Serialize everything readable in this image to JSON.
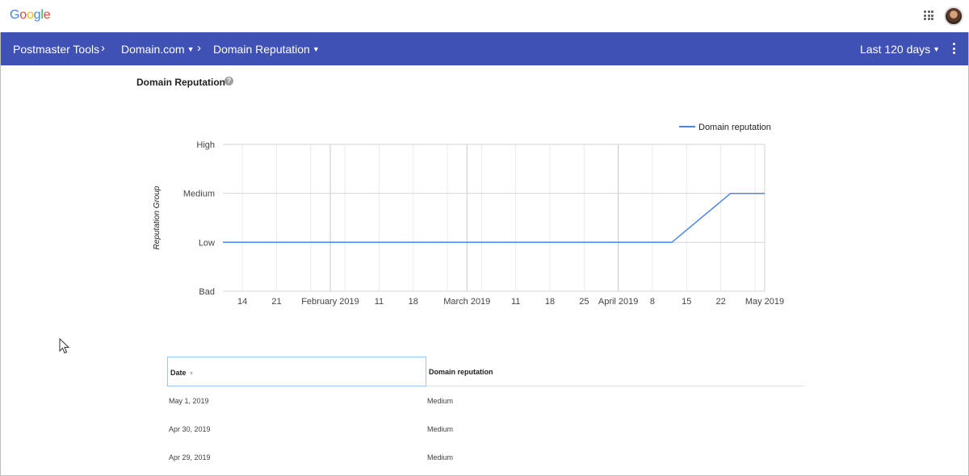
{
  "app": {
    "logo_letters": [
      {
        "ch": "G",
        "color": "#4285F4"
      },
      {
        "ch": "o",
        "color": "#EA4335"
      },
      {
        "ch": "o",
        "color": "#FBBC05"
      },
      {
        "ch": "g",
        "color": "#4285F4"
      },
      {
        "ch": "l",
        "color": "#34A853"
      },
      {
        "ch": "e",
        "color": "#EA4335"
      }
    ],
    "apps_icon": "apps-grid-icon",
    "avatar_icon": "user-avatar"
  },
  "appbar": {
    "color": "#3f51b5",
    "product": "Postmaster Tools",
    "domain": "Domain.com",
    "section": "Domain Reputation",
    "range": "Last 120 days",
    "chevron_icon": "chevron-right-icon",
    "caret_icon": "dropdown-caret-icon",
    "more_icon": "more-vert-icon"
  },
  "page": {
    "title": "Domain Reputation",
    "help_icon": "help-icon",
    "help_glyph": "?"
  },
  "chart_data": {
    "type": "line",
    "ylabel": "Reputation Group",
    "y_categories": [
      "Bad",
      "Low",
      "Medium",
      "High"
    ],
    "x_ticks": [
      "14",
      "21",
      "February 2019",
      "11",
      "18",
      "March 2019",
      "11",
      "18",
      "25",
      "April 2019",
      "8",
      "15",
      "22",
      "May 2019"
    ],
    "x_range": [
      "2019-01-10",
      "2019-05-01"
    ],
    "grid": true,
    "legend_position": "top-right",
    "series": [
      {
        "name": "Domain reputation",
        "color": "#4a86e8",
        "points": [
          {
            "x": "2019-01-10",
            "y": "Low"
          },
          {
            "x": "2019-04-12",
            "y": "Low"
          },
          {
            "x": "2019-04-24",
            "y": "Medium"
          },
          {
            "x": "2019-05-01",
            "y": "Medium"
          }
        ]
      }
    ]
  },
  "table": {
    "headers": {
      "date": "Date",
      "reputation": "Domain reputation"
    },
    "sort_icon": "sort-desc-icon",
    "rows": [
      {
        "date": "May 1, 2019",
        "reputation": "Medium"
      },
      {
        "date": "Apr 30, 2019",
        "reputation": "Medium"
      },
      {
        "date": "Apr 29, 2019",
        "reputation": "Medium"
      }
    ]
  }
}
